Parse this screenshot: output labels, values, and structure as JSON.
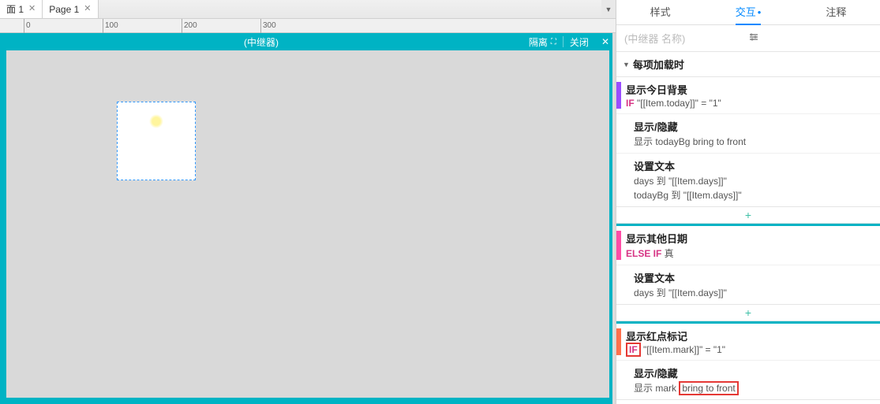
{
  "tabs": {
    "t1": "面 1",
    "t2": "Page 1"
  },
  "ruler": {
    "r0": "0",
    "r100": "100",
    "r200": "200",
    "r300": "300"
  },
  "editbar": {
    "title": "(中继器)",
    "isolate": "隔离",
    "close": "关闭"
  },
  "rtabs": {
    "style": "样式",
    "interact": "交互",
    "notes": "注释",
    "dot": "•"
  },
  "repeater_name": "(中继器 名称)",
  "section": "每项加载时",
  "c1": {
    "name": "显示今日背景",
    "kw": "IF",
    "cond": " \"[[Item.today]]\" = \"1\""
  },
  "a1": {
    "name": "显示/隐藏",
    "detail": "显示 todayBg  bring to front"
  },
  "a2": {
    "name": "设置文本",
    "d1": "days 到 \"[[Item.days]]\"",
    "d2": "todayBg 到 \"[[Item.days]]\""
  },
  "c2": {
    "name": "显示其他日期",
    "kw": "ELSE IF",
    "cond": " 真"
  },
  "a3": {
    "name": "设置文本",
    "detail": "days 到 \"[[Item.days]]\""
  },
  "c3": {
    "name": "显示红点标记",
    "kw": "IF",
    "cond": " \"[[Item.mark]]\" = \"1\""
  },
  "a4": {
    "name": "显示/隐藏",
    "pre": "显示 mark ",
    "btf": "bring to front"
  },
  "plus": "+"
}
